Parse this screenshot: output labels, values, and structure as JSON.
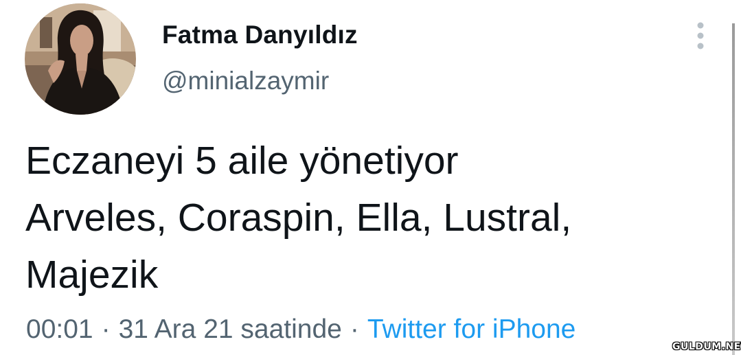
{
  "author": {
    "display_name": "Fatma Danyıldız",
    "handle": "@minialzaymir"
  },
  "tweet": {
    "lines": [
      "Eczaneyi 5 aile yönetiyor",
      "Arveles, Coraspin, Ella, Lustral,",
      "Majezik"
    ]
  },
  "meta": {
    "time": "00:01",
    "date": "31 Ara 21 saatinde",
    "separator": "·",
    "source": "Twitter for iPhone"
  },
  "icons": {
    "more": "more-vertical-icon",
    "avatar": "profile-photo"
  },
  "watermark": "GULDUM.NET",
  "colors": {
    "text": "#0f1419",
    "secondary": "#536471",
    "link": "#1d9bf0"
  }
}
